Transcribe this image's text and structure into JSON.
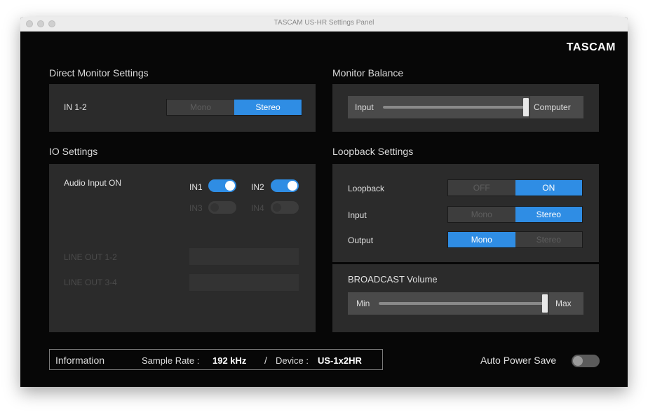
{
  "window": {
    "title": "TASCAM US-HR Settings Panel"
  },
  "brand": "TASCAM",
  "direct_monitor": {
    "title": "Direct Monitor Settings",
    "channel_label": "IN 1-2",
    "options": [
      "Mono",
      "Stereo"
    ],
    "selected": "Stereo"
  },
  "monitor_balance": {
    "title": "Monitor Balance",
    "left_label": "Input",
    "right_label": "Computer",
    "value_fraction": 0.98
  },
  "io_settings": {
    "title": "IO Settings",
    "audio_input_label": "Audio Input ON",
    "inputs": [
      {
        "label": "IN1",
        "state": "on"
      },
      {
        "label": "IN2",
        "state": "on"
      },
      {
        "label": "IN3",
        "state": "disabled"
      },
      {
        "label": "IN4",
        "state": "disabled"
      }
    ],
    "line_out_1_2_label": "LINE OUT 1-2",
    "line_out_3_4_label": "LINE OUT 3-4"
  },
  "loopback": {
    "title": "Loopback Settings",
    "loopback_label": "Loopback",
    "loopback_options": [
      "OFF",
      "ON"
    ],
    "loopback_selected": "ON",
    "input_label": "Input",
    "input_options": [
      "Mono",
      "Stereo"
    ],
    "input_selected": "Stereo",
    "output_label": "Output",
    "output_options": [
      "Mono",
      "Stereo"
    ],
    "output_selected": "Mono"
  },
  "broadcast": {
    "title": "BROADCAST Volume",
    "min_label": "Min",
    "max_label": "Max",
    "value_fraction": 0.98
  },
  "information": {
    "label": "Information",
    "sample_rate_label": "Sample Rate :",
    "sample_rate_value": "192 kHz",
    "separator": "/",
    "device_label": "Device :",
    "device_value": "US-1x2HR"
  },
  "auto_power_save": {
    "label": "Auto Power Save",
    "state": "off"
  },
  "colors": {
    "accent": "#2f8de4",
    "window_bg": "#070707",
    "panel_bg": "#2b2b2b"
  }
}
